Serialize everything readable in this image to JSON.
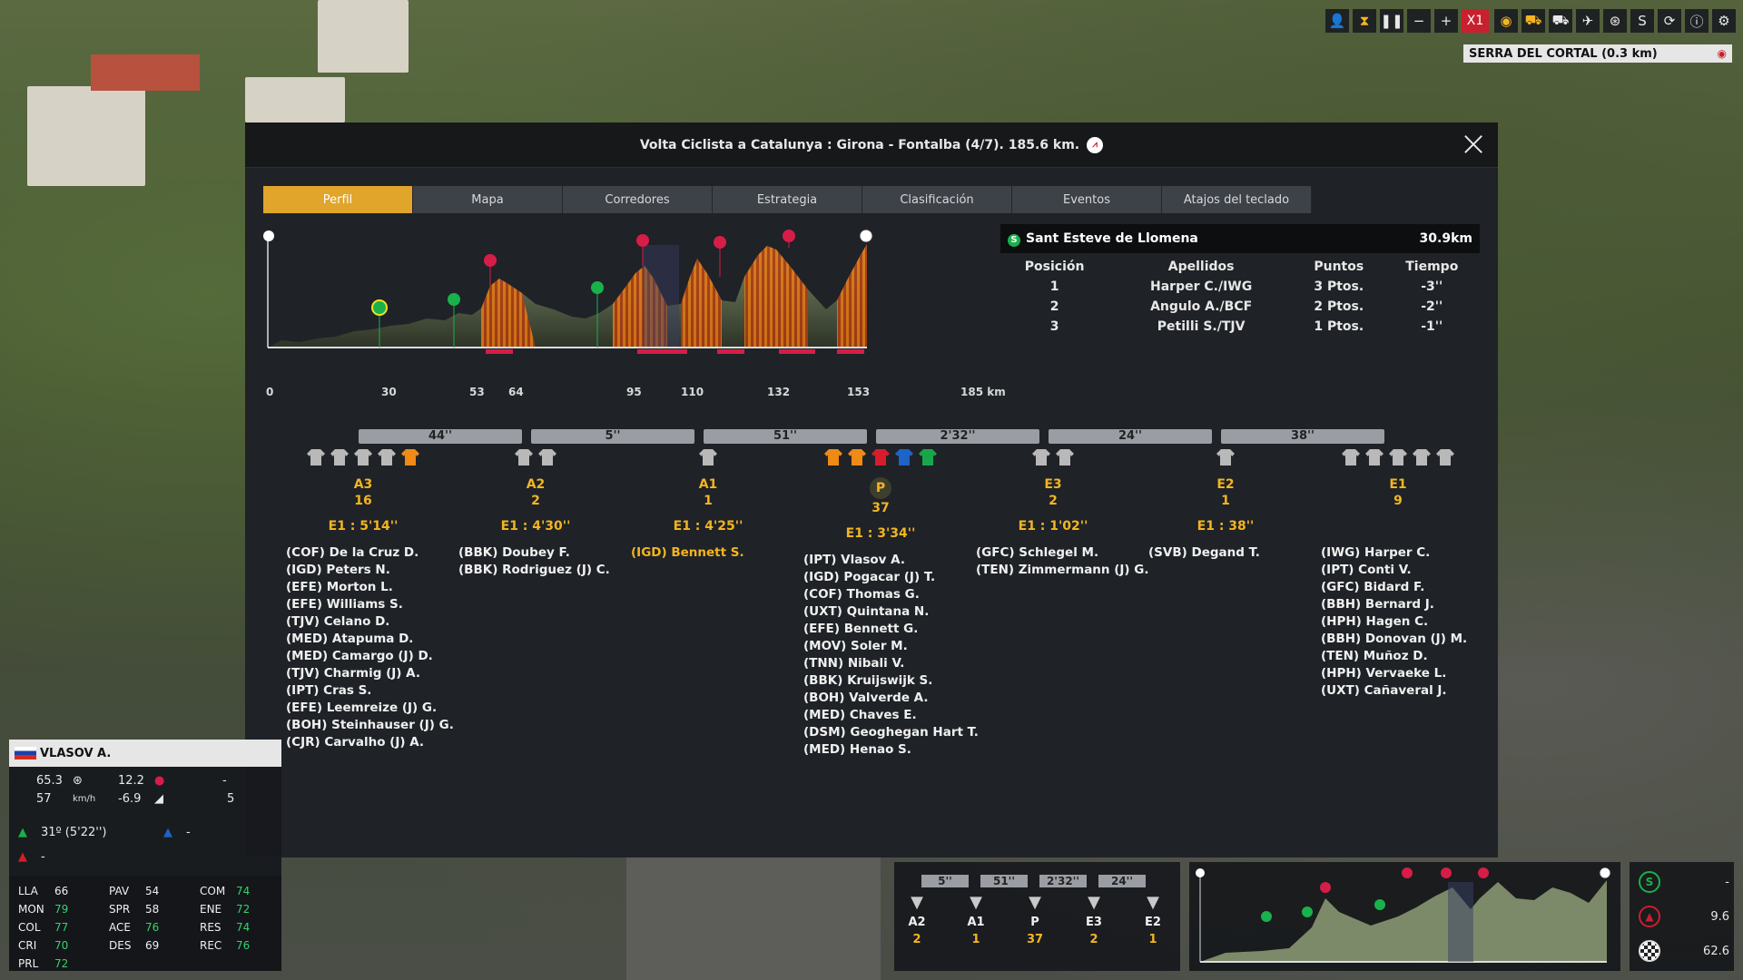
{
  "toolbar": {
    "speed_label": "X1",
    "location": "SERRA DEL CORTAL (0.3 km)"
  },
  "modal": {
    "title": "Volta Ciclista a Catalunya : Girona - Fontalba (4/7). 185.6 km.",
    "close": "╳",
    "tabs": [
      "Perfil",
      "Mapa",
      "Corredores",
      "Estrategia",
      "Clasificación",
      "Eventos",
      "Atajos del teclado"
    ]
  },
  "profile": {
    "km_marks": [
      "0",
      "30",
      "53",
      "64",
      "95",
      "110",
      "132",
      "153",
      "185 km"
    ]
  },
  "sprint": {
    "name": "Sant Esteve de Llomena",
    "distance": "30.9km",
    "headers": [
      "Posición",
      "Apellidos",
      "Puntos",
      "Tiempo"
    ],
    "rows": [
      [
        "1",
        "Harper C./IWG",
        "3 Ptos.",
        "-3''"
      ],
      [
        "2",
        "Angulo A./BCF",
        "2 Ptos.",
        "-2''"
      ],
      [
        "3",
        "Petilli S./TJV",
        "1 Ptos.",
        "-1''"
      ]
    ]
  },
  "gaps": [
    "44''",
    "5''",
    "51''",
    "2'32''",
    "24''",
    "38''"
  ],
  "groups": [
    {
      "name": "A3",
      "count": "16",
      "time": "E1 : 5'14''",
      "jerseys": [
        "#b9b9b9",
        "#b9b9b9",
        "#b9b9b9",
        "#b9b9b9",
        "#f08a17"
      ],
      "riders": [
        "(COF) De la Cruz D.",
        "(IGD) Peters N.",
        "(EFE) Morton L.",
        "(EFE) Williams S.",
        "(TJV) Celano D.",
        "(MED) Atapuma D.",
        "(MED) Camargo (J) D.",
        "(TJV) Charmig (J) A.",
        "(IPT) Cras S.",
        "(EFE) Leemreize (J) G.",
        "(BOH) Steinhauser (J) G.",
        "(CJR) Carvalho (J) A."
      ]
    },
    {
      "name": "A2",
      "count": "2",
      "time": "E1 : 4'30''",
      "jerseys": [
        "#b9b9b9",
        "#b9b9b9"
      ],
      "riders": [
        "(BBK) Doubey F.",
        "(BBK) Rodriguez (J) C."
      ]
    },
    {
      "name": "A1",
      "count": "1",
      "time": "E1 : 4'25''",
      "jerseys": [
        "#b9b9b9"
      ],
      "riders": [
        "(IGD) Bennett S."
      ]
    },
    {
      "name": "P",
      "count": "37",
      "time": "E1 : 3'34''",
      "jerseys": [
        "#f08a17",
        "#f08a17",
        "#d61d2b",
        "#1e63c8",
        "#19a64b"
      ],
      "riders": [
        "(IPT) Vlasov A.",
        "(IGD) Pogacar (J) T.",
        "(COF) Thomas G.",
        "(UXT) Quintana N.",
        "(EFE) Bennett G.",
        "(MOV) Soler M.",
        "(TNN) Nibali V.",
        "(BBK) Kruijswijk S.",
        "(BOH) Valverde A.",
        "(MED) Chaves E.",
        "(DSM) Geoghegan Hart T.",
        "(MED) Henao S."
      ]
    },
    {
      "name": "E3",
      "count": "2",
      "time": "E1 : 1'02''",
      "jerseys": [
        "#b9b9b9",
        "#b9b9b9"
      ],
      "riders": [
        "(GFC) Schlegel M.",
        "(TEN) Zimmermann (J) G."
      ]
    },
    {
      "name": "E2",
      "count": "1",
      "time": "E1 : 38''",
      "jerseys": [
        "#b9b9b9"
      ],
      "riders": [
        "(SVB) Degand T."
      ]
    },
    {
      "name": "E1",
      "count": "9",
      "time": "",
      "jerseys": [
        "#b9b9b9",
        "#b9b9b9",
        "#b9b9b9",
        "#b9b9b9",
        "#b9b9b9"
      ],
      "riders": [
        "(IWG) Harper C.",
        "(IPT) Conti V.",
        "(GFC) Bidard F.",
        "(BBH) Bernard J.",
        "(HPH) Hagen C.",
        "(BBH) Donovan (J) M.",
        "(TEN) Muñoz D.",
        "(HPH) Vervaeke L.",
        "(UXT) Cañaveral J."
      ]
    }
  ],
  "rider_panel": {
    "name": "VLASOV A.",
    "val1": "65.3",
    "val2": "12.2",
    "val3": "-",
    "speed": "57",
    "speed_unit": "km/h",
    "slope": "-6.9",
    "val6": "5",
    "green_rank": "31º (5'22'')",
    "blue_rank": "-",
    "red_rank": "-",
    "stats": [
      [
        "LLA",
        "66",
        false
      ],
      [
        "PAV",
        "54",
        false
      ],
      [
        "COM",
        "74",
        true
      ],
      [
        "MON",
        "79",
        true
      ],
      [
        "SPR",
        "58",
        false
      ],
      [
        "ENE",
        "72",
        true
      ],
      [
        "COL",
        "77",
        true
      ],
      [
        "ACE",
        "76",
        true
      ],
      [
        "RES",
        "74",
        true
      ],
      [
        "CRI",
        "70",
        true
      ],
      [
        "DES",
        "69",
        false
      ],
      [
        "REC",
        "76",
        true
      ],
      [
        "PRL",
        "72",
        true
      ]
    ]
  },
  "mini_groups": {
    "gaps": [
      "5''",
      "51''",
      "2'32''",
      "24''"
    ],
    "cols": [
      [
        "A2",
        "2"
      ],
      [
        "A1",
        "1"
      ],
      [
        "P",
        "37"
      ],
      [
        "E3",
        "2"
      ],
      [
        "E2",
        "1"
      ]
    ]
  },
  "mini_stats": {
    "s": "-",
    "climb": "9.6",
    "finish": "62.6"
  }
}
